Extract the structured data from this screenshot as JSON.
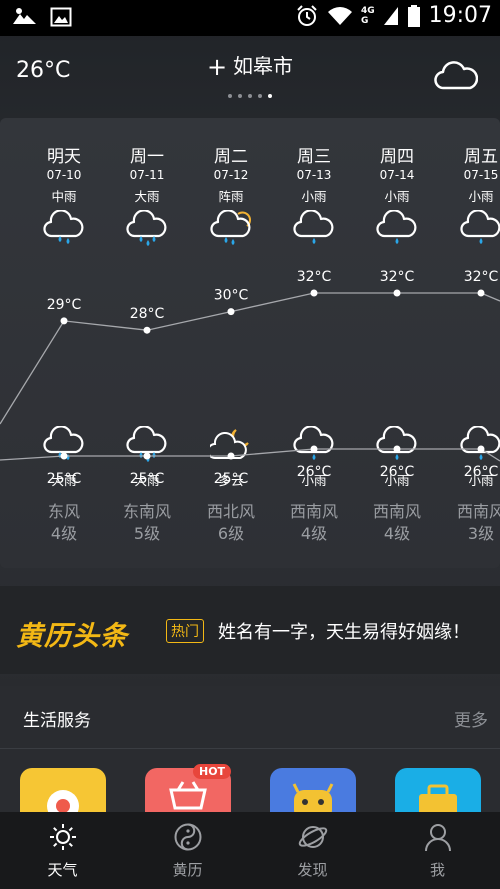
{
  "status_bar": {
    "time": "19:07",
    "network": [
      "4G",
      "G"
    ],
    "icons": [
      "mountain-icon",
      "image-icon",
      "alarm-icon",
      "wifi-icon",
      "signal-icon",
      "battery-icon"
    ]
  },
  "header": {
    "current_temp": "26°C",
    "city": "如皋市",
    "add_symbol": "+",
    "page_dots": 5,
    "active_dot": 4,
    "weather_icon": "cloud-icon"
  },
  "forecast": {
    "days": [
      {
        "day": "明天",
        "date": "07-10",
        "weather_day": "中雨",
        "icon_day": "rain-icon",
        "high": "29°C",
        "low": "25°C",
        "icon_night": "rain-icon",
        "weather_night": "大雨",
        "wind": "东风",
        "level": "4级"
      },
      {
        "day": "周一",
        "date": "07-11",
        "weather_day": "大雨",
        "icon_day": "heavy-rain-icon",
        "high": "28°C",
        "low": "25°C",
        "icon_night": "heavy-rain-icon",
        "weather_night": "大雨",
        "wind": "东南风",
        "level": "5级"
      },
      {
        "day": "周二",
        "date": "07-12",
        "weather_day": "阵雨",
        "icon_day": "shower-sun-icon",
        "high": "30°C",
        "low": "25°C",
        "icon_night": "cloudy-moon-icon",
        "weather_night": "多云",
        "wind": "西北风",
        "level": "6级"
      },
      {
        "day": "周三",
        "date": "07-13",
        "weather_day": "小雨",
        "icon_day": "light-rain-icon",
        "high": "32°C",
        "low": "26°C",
        "icon_night": "light-rain-icon",
        "weather_night": "小雨",
        "wind": "西南风",
        "level": "4级"
      },
      {
        "day": "周四",
        "date": "07-14",
        "weather_day": "小雨",
        "icon_day": "light-rain-icon",
        "high": "32°C",
        "low": "26°C",
        "icon_night": "light-rain-icon",
        "weather_night": "小雨",
        "wind": "西南风",
        "level": "4级"
      },
      {
        "day": "周五",
        "date": "07-15",
        "weather_day": "小雨",
        "icon_day": "light-rain-icon",
        "high": "32°C",
        "low": "26°C",
        "icon_night": "light-rain-icon",
        "weather_night": "小雨",
        "wind": "西南风",
        "level": "3级"
      }
    ],
    "high_values": [
      29,
      28,
      30,
      32,
      32,
      32
    ],
    "low_values": [
      25,
      25,
      25,
      26,
      26,
      26
    ]
  },
  "banner": {
    "logo": "黄历头条",
    "tag": "热门",
    "text": "姓名有一字，天生易得好姻缘！"
  },
  "services": {
    "title": "生活服务",
    "more": "更多",
    "hot_badge": "HOT",
    "tile_colors": [
      "#f6c634",
      "#f26763",
      "#4a7be0",
      "#1aaee6"
    ]
  },
  "bottom_nav": [
    {
      "label": "天气",
      "icon": "sun-icon",
      "active": true
    },
    {
      "label": "黄历",
      "icon": "taiji-icon",
      "active": false
    },
    {
      "label": "发现",
      "icon": "planet-icon",
      "active": false
    },
    {
      "label": "我",
      "icon": "user-icon",
      "active": false
    }
  ]
}
